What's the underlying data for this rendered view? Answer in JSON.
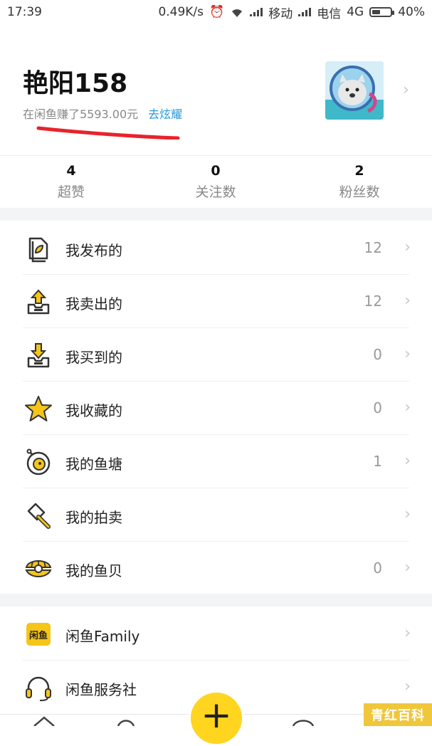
{
  "status_bar": {
    "time": "17:39",
    "speed": "0.49K/s",
    "carrier1": "移动",
    "carrier2": "电信",
    "network": "4G",
    "battery": "40%"
  },
  "profile": {
    "username": "艳阳158",
    "earned_text": "在闲鱼赚了5593.00元",
    "show_off_link": "去炫耀"
  },
  "stats": [
    {
      "value": "4",
      "label": "超赞"
    },
    {
      "value": "0",
      "label": "关注数"
    },
    {
      "value": "2",
      "label": "粉丝数"
    }
  ],
  "menu_main": [
    {
      "label": "我发布的",
      "count": "12",
      "icon": "document-leaf-icon"
    },
    {
      "label": "我卖出的",
      "count": "12",
      "icon": "box-upload-icon"
    },
    {
      "label": "我买到的",
      "count": "0",
      "icon": "box-download-icon"
    },
    {
      "label": "我收藏的",
      "count": "0",
      "icon": "star-icon"
    },
    {
      "label": "我的鱼塘",
      "count": "1",
      "icon": "pond-icon"
    },
    {
      "label": "我的拍卖",
      "count": "",
      "icon": "auction-hammer-icon"
    },
    {
      "label": "我的鱼贝",
      "count": "0",
      "icon": "shell-icon"
    }
  ],
  "menu_secondary": [
    {
      "label": "闲鱼Family",
      "icon": "family-badge-icon"
    },
    {
      "label": "闲鱼服务社",
      "icon": "headset-icon"
    }
  ],
  "fab_label": "+",
  "watermark": "青红百科",
  "colors": {
    "accent_yellow": "#ffd51f",
    "link_blue": "#2a9ad8",
    "underline_red": "#e8232b"
  }
}
